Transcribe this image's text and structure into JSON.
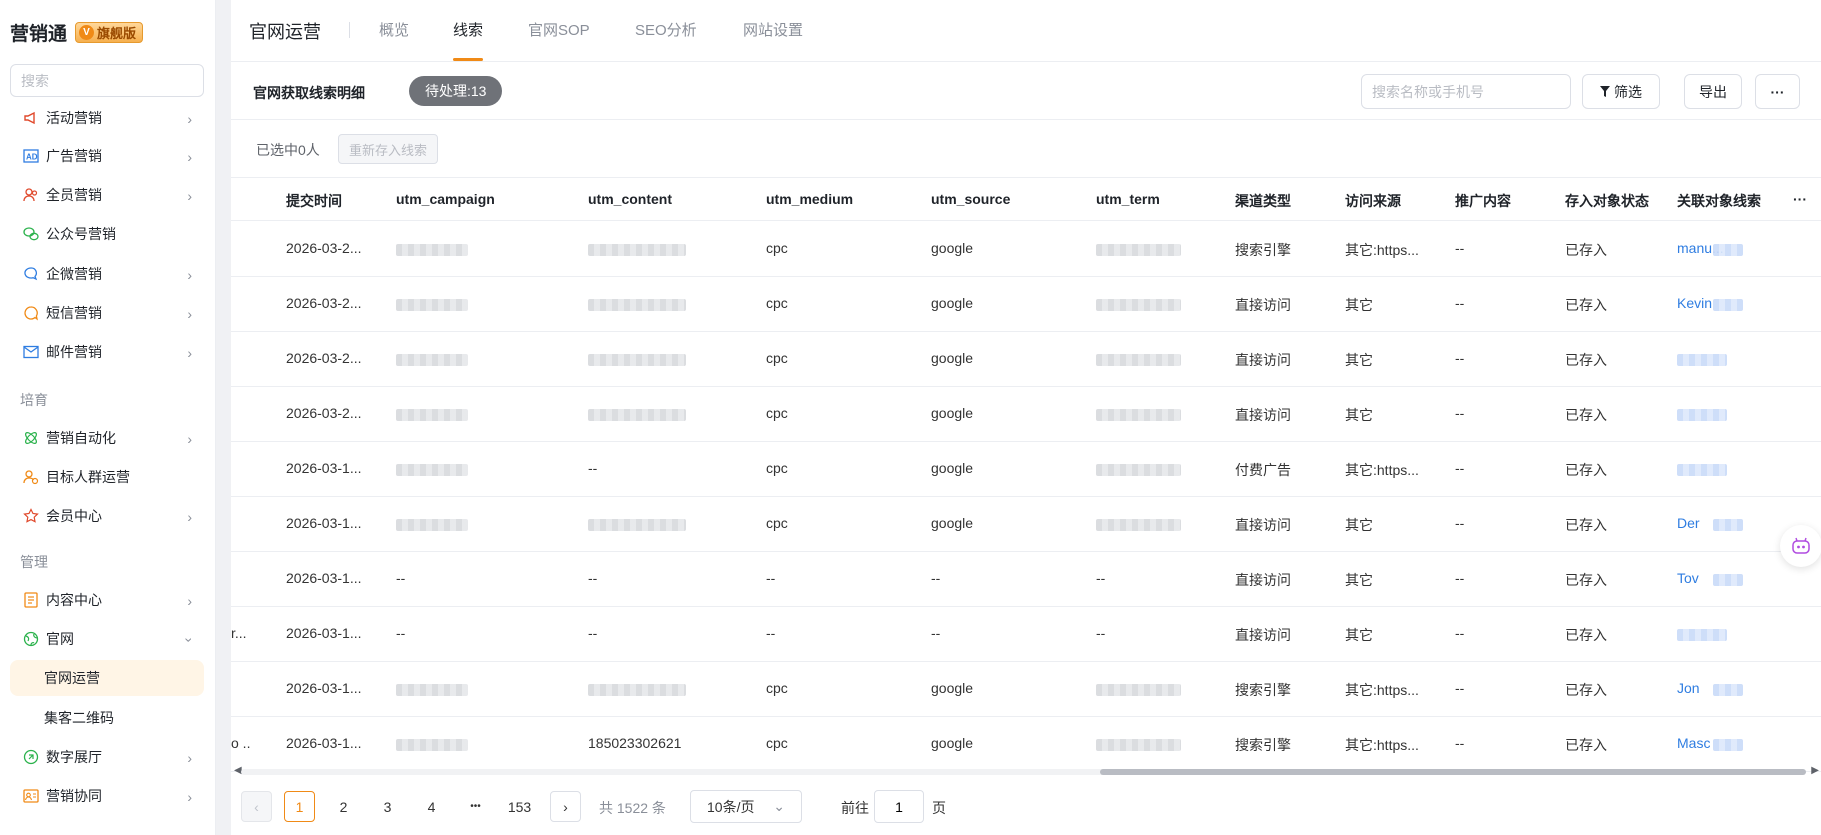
{
  "brand": {
    "name": "营销通",
    "badge": "旗舰版"
  },
  "sidebar": {
    "search_placeholder": "搜索",
    "items": [
      {
        "label": "活动营销",
        "icon": "megaphone-icon"
      },
      {
        "label": "广告营销",
        "icon": "ad-icon"
      },
      {
        "label": "全员营销",
        "icon": "people-icon"
      },
      {
        "label": "公众号营销",
        "icon": "wechat-icon"
      },
      {
        "label": "企微营销",
        "icon": "chat-icon"
      },
      {
        "label": "短信营销",
        "icon": "sms-icon"
      },
      {
        "label": "邮件营销",
        "icon": "mail-icon"
      }
    ],
    "group_nurture": "培育",
    "nurture_items": [
      {
        "label": "营销自动化",
        "icon": "automation-icon"
      },
      {
        "label": "目标人群运营",
        "icon": "target-icon"
      },
      {
        "label": "会员中心",
        "icon": "member-icon"
      }
    ],
    "group_manage": "管理",
    "manage_items": [
      {
        "label": "内容中心",
        "icon": "document-icon"
      },
      {
        "label": "官网",
        "icon": "globe-icon"
      },
      {
        "label": "官网运营"
      },
      {
        "label": "集客二维码"
      },
      {
        "label": "数字展厅",
        "icon": "hall-icon"
      },
      {
        "label": "营销协同",
        "icon": "collab-icon"
      }
    ]
  },
  "header": {
    "section_title": "官网运营",
    "tabs": [
      "概览",
      "线索",
      "官网SOP",
      "SEO分析",
      "网站设置"
    ],
    "active_tab": "线索"
  },
  "toolbar": {
    "title": "官网获取线索明细",
    "pending_badge": "待处理:13",
    "search_placeholder": "搜索名称或手机号",
    "filter_label": "筛选",
    "export_label": "导出",
    "more_label": "···"
  },
  "selection": {
    "selected_text": "已选中0人",
    "restore_label": "重新存入线索"
  },
  "table": {
    "columns": [
      "提交时间",
      "utm_campaign",
      "utm_content",
      "utm_medium",
      "utm_source",
      "utm_term",
      "渠道类型",
      "访问来源",
      "推广内容",
      "存入对象状态",
      "关联对象线索",
      "···"
    ],
    "rows": [
      {
        "lead": "",
        "time": "2026-03-2...",
        "campaign": "",
        "content": "",
        "medium": "cpc",
        "source": "google",
        "term": "",
        "channel": "搜索引擎",
        "origin": "其它:https...",
        "promo": "--",
        "status": "已存入",
        "linked": "manu..."
      },
      {
        "lead": "",
        "time": "2026-03-2...",
        "campaign": "",
        "content": "",
        "medium": "cpc",
        "source": "google",
        "term": "",
        "channel": "直接访问",
        "origin": "其它",
        "promo": "--",
        "status": "已存入",
        "linked": "Kevin"
      },
      {
        "lead": "",
        "time": "2026-03-2...",
        "campaign": "",
        "content": "",
        "medium": "cpc",
        "source": "google",
        "term": "",
        "channel": "直接访问",
        "origin": "其它",
        "promo": "--",
        "status": "已存入",
        "linked": ""
      },
      {
        "lead": "",
        "time": "2026-03-2...",
        "campaign": "",
        "content": "",
        "medium": "cpc",
        "source": "google",
        "term": "",
        "channel": "直接访问",
        "origin": "其它",
        "promo": "--",
        "status": "已存入",
        "linked": ""
      },
      {
        "lead": "",
        "time": "2026-03-1...",
        "campaign": "",
        "content": "--",
        "medium": "cpc",
        "source": "google",
        "term": "",
        "channel": "付费广告",
        "origin": "其它:https...",
        "promo": "--",
        "status": "已存入",
        "linked": ""
      },
      {
        "lead": "",
        "time": "2026-03-1...",
        "campaign": "",
        "content": "",
        "medium": "cpc",
        "source": "google",
        "term": "",
        "channel": "直接访问",
        "origin": "其它",
        "promo": "--",
        "status": "已存入",
        "linked": "Der"
      },
      {
        "lead": "",
        "time": "2026-03-1...",
        "campaign": "--",
        "content": "--",
        "medium": "--",
        "source": "--",
        "term": "--",
        "channel": "直接访问",
        "origin": "其它",
        "promo": "--",
        "status": "已存入",
        "linked": "Tov"
      },
      {
        "lead": "r...",
        "time": "2026-03-1...",
        "campaign": "--",
        "content": "--",
        "medium": "--",
        "source": "--",
        "term": "--",
        "channel": "直接访问",
        "origin": "其它",
        "promo": "--",
        "status": "已存入",
        "linked": ""
      },
      {
        "lead": "",
        "time": "2026-03-1...",
        "campaign": "",
        "content": "",
        "medium": "cpc",
        "source": "google",
        "term": "",
        "channel": "搜索引擎",
        "origin": "其它:https...",
        "promo": "--",
        "status": "已存入",
        "linked": "Jon"
      },
      {
        "lead": "o ...",
        "time": "2026-03-1...",
        "campaign": "",
        "content": "185023302621",
        "medium": "cpc",
        "source": "google",
        "term": "",
        "channel": "搜索引擎",
        "origin": "其它:https...",
        "promo": "--",
        "status": "已存入",
        "linked": "Masc"
      }
    ]
  },
  "pagination": {
    "pages": [
      "1",
      "2",
      "3",
      "4",
      "•••",
      "153"
    ],
    "current": "1",
    "total": "共 1522 条",
    "page_size": "10条/页",
    "goto_label": "前往",
    "goto_value": "1",
    "page_suffix": "页"
  },
  "colors": {
    "accent": "#f08a16",
    "link": "#2f7de1",
    "pending_bg": "#6f7278"
  }
}
